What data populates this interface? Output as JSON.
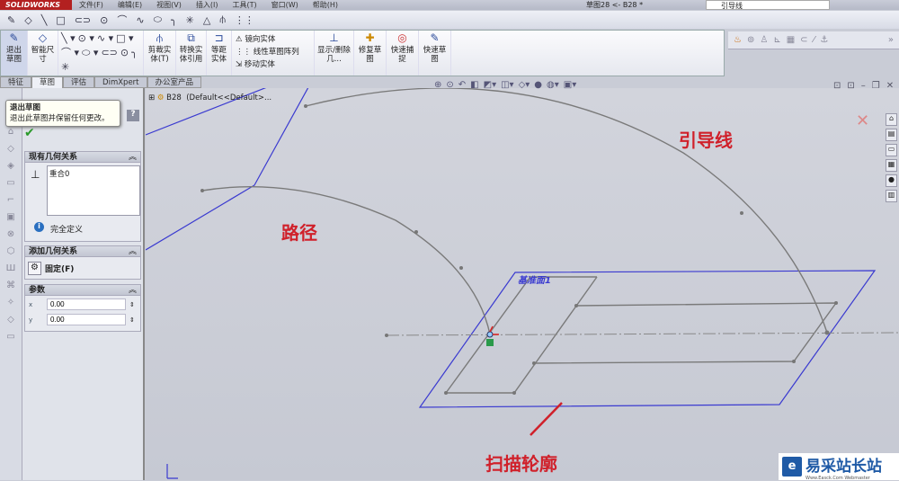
{
  "app": {
    "logo": "SOLIDWORKS",
    "menu": [
      "文件(F)",
      "编辑(E)",
      "视图(V)",
      "插入(I)",
      "工具(T)",
      "窗口(W)",
      "帮助(H)"
    ],
    "doc_title": "草图28 <- B28 *",
    "search_value": "引导线"
  },
  "ribbon": {
    "exit_sketch": "退出草图",
    "smart_dim": "智能尺寸",
    "trim": "剪裁实体(T)",
    "convert": "转换实体引用",
    "offset": "等距实体",
    "mirror": "镜向实体",
    "linear_pattern": "线性草图阵列",
    "move": "移动实体",
    "show_delete": "显示/删除几...",
    "repair": "修复草图",
    "quick_snap": "快速捕捉",
    "rapid_sketch": "快速草图"
  },
  "tabs": [
    "特征",
    "草图",
    "评估",
    "DimXpert",
    "办公室产品"
  ],
  "tooltip": {
    "title": "退出草图",
    "text": "退出此草图并保留任何更改。"
  },
  "property_manager": {
    "existing_relations": {
      "title": "现有几何关系",
      "items": [
        "重合0"
      ],
      "status": "完全定义"
    },
    "add_relations": {
      "title": "添加几何关系",
      "items": [
        "固定(F)"
      ]
    },
    "parameters": {
      "title": "参数",
      "x": "0.00",
      "y": "0.00",
      "x_label": "x",
      "y_label": "y"
    },
    "help": "?"
  },
  "tree": {
    "name": "B28",
    "config": "(Default<<Default>..."
  },
  "annotations": {
    "path": "路径",
    "guide": "引导线",
    "profile": "扫描轮廓",
    "plane": "基准面1"
  },
  "watermark": {
    "text": "易采站长站",
    "sub": "Www.Easck.Com Webmaster"
  },
  "colors": {
    "annotation": "#d0202a",
    "plane": "#3a3ad0",
    "sketch": "#777777"
  }
}
